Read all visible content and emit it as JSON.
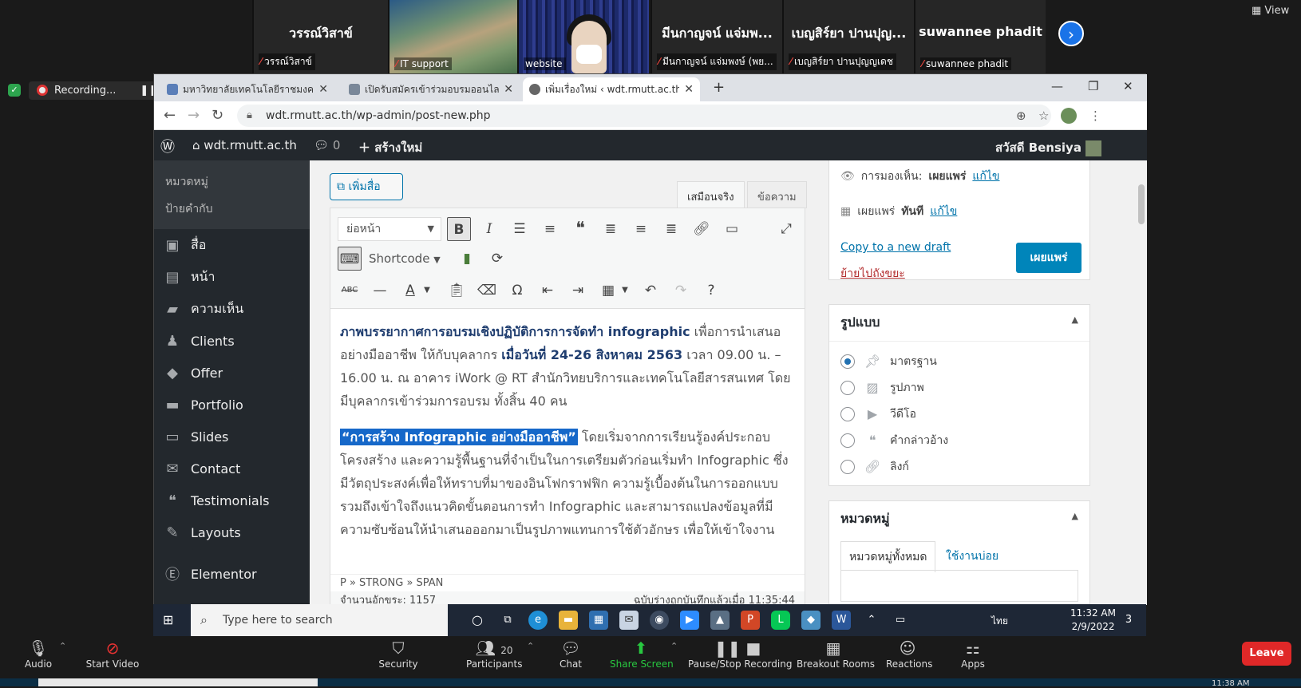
{
  "zoom": {
    "tiles": [
      {
        "name": "วรรณ์วิสาข์",
        "label": "วรรณ์วิสาข์"
      },
      {
        "name": "",
        "label": "IT support"
      },
      {
        "name": "",
        "label": "website"
      },
      {
        "name": "มีนกาญจน์ แจ่มพ...",
        "label": "มีนกาญจน์ แจ่มพงษ์ (พย..."
      },
      {
        "name": "เบญสิร์ยา ปานปุญ...",
        "label": "เบญสิร์ยา ปานปุญญเดช"
      },
      {
        "name": "suwannee phadit",
        "label": "suwannee phadit"
      }
    ],
    "view_label": "View",
    "recording_label": "Recording...",
    "controls": {
      "audio": "Audio",
      "start_video": "Start Video",
      "security": "Security",
      "participants": "Participants",
      "participants_count": "20",
      "chat": "Chat",
      "share_screen": "Share Screen",
      "pause_recording": "Pause/Stop Recording",
      "breakout_rooms": "Breakout Rooms",
      "reactions": "Reactions",
      "apps": "Apps",
      "leave": "Leave"
    },
    "bottom_time": "11:38 AM"
  },
  "browser": {
    "tabs": [
      {
        "title": "มหาวิทยาลัยเทคโนโลยีราชมงคลธัญบุรี"
      },
      {
        "title": "เปิดรับสมัครเข้าร่วมอบรมออนไลน์ สำห"
      },
      {
        "title": "เพิ่มเรื่องใหม่ ‹ wdt.rmutt.ac.th — W"
      }
    ],
    "url": "wdt.rmutt.ac.th/wp-admin/post-new.php"
  },
  "wp": {
    "site_name": "wdt.rmutt.ac.th",
    "comments_count": "0",
    "new_label": "สร้างใหม่",
    "greeting": "สวัสดี Bensiya",
    "submenu": [
      "หมวดหมู่",
      "ป้ายคำกับ"
    ],
    "menu": [
      {
        "label": "สื่อ",
        "icon": "media-icon"
      },
      {
        "label": "หน้า",
        "icon": "pages-icon"
      },
      {
        "label": "ความเห็น",
        "icon": "comments-icon"
      },
      {
        "label": "Clients",
        "icon": "clients-icon"
      },
      {
        "label": "Offer",
        "icon": "offer-icon"
      },
      {
        "label": "Portfolio",
        "icon": "portfolio-icon"
      },
      {
        "label": "Slides",
        "icon": "slides-icon"
      },
      {
        "label": "Contact",
        "icon": "contact-icon"
      },
      {
        "label": "Testimonials",
        "icon": "testimonials-icon"
      },
      {
        "label": "Layouts",
        "icon": "layouts-icon"
      },
      {
        "label": "Elementor",
        "icon": "elementor-icon"
      }
    ],
    "add_media": "เพิ่มสื่อ",
    "tab_visual": "เสมือนจริง",
    "tab_text": "ข้อความ",
    "format_select": "ย่อหน้า",
    "shortcode": "Shortcode",
    "content": {
      "p1_bold": "ภาพบรรยากาศการอบรมเชิงปฏิบัติการการจัดทำ infographic",
      "p1_a": " เพื่อการนำเสนออย่างมืออาชีพ ให้กับบุคลากร ",
      "p1_date": "เมื่อวันที่ 24-26 สิงหาคม 2563",
      "p1_b": " เวลา 09.00 น. – 16.00 น. ณ อาคาร iWork @ RT สำนักวิทยบริการและเทคโนโลยีสารสนเทศ โดยมีบุคลากรเข้าร่วมการอบรม ทั้งสิ้น 40 คน",
      "p2_highlight": "“การสร้าง Infographic อย่างมืออาชีพ”",
      "p2_rest": " โดยเริ่มจากการเรียนรู้องค์ประกอบโครงสร้าง และความรู้พื้นฐานที่จำเป็นในการเตรียมตัวก่อนเริ่มทำ Infographic ซึ่งมีวัตถุประสงค์เพื่อให้ทราบที่มาของอินโฟกราฟฟิก ความรู้เบื้องต้นในการออกแบบ รวมถึงเข้าใจถึงแนวคิดขั้นตอนการทำ Infographic และสามารถแปลงข้อมูลที่มีความซับซ้อนให้นำเสนอออกมาเป็นรูปภาพแทนการใช้ตัวอักษร เพื่อให้เข้าใจงาน"
    },
    "path": "P » STRONG » SPAN",
    "word_count": "จำนวนอักขระ: 1157",
    "draft_saved": "ฉบับร่างถูกบันทึกแล้วเมื่อ 11:35:44",
    "publish": {
      "visibility_label": "การมองเห็น:",
      "visibility_value": "เผยแพร่",
      "edit": "แก้ไข",
      "publish_label": "เผยแพร่",
      "publish_when": "ทันที",
      "copy_draft": "Copy to a new draft",
      "trash": "ย้ายไปถังขยะ",
      "button": "เผยแพร่"
    },
    "format_box": {
      "title": "รูปแบบ",
      "options": [
        {
          "label": "มาตรฐาน",
          "selected": true,
          "icon": "pin-icon"
        },
        {
          "label": "รูปภาพ",
          "selected": false,
          "icon": "image-icon"
        },
        {
          "label": "วีดีโอ",
          "selected": false,
          "icon": "video-icon"
        },
        {
          "label": "คำกล่าวอ้าง",
          "selected": false,
          "icon": "quote-icon"
        },
        {
          "label": "ลิงก์",
          "selected": false,
          "icon": "link-icon"
        }
      ]
    },
    "category_box": {
      "title": "หมวดหมู่",
      "tab_all": "หมวดหมู่ทั้งหมด",
      "tab_popular": "ใช้งานบ่อย"
    }
  },
  "taskbar": {
    "search_placeholder": "Type here to search",
    "lang": "ไทย",
    "time": "11:32 AM",
    "date": "2/9/2022",
    "notif_count": "3"
  },
  "colors": {
    "wp_dark": "#23282d",
    "wp_blue": "#0073aa",
    "highlight": "#1668c9",
    "zoom_leave": "#e02828",
    "share_green": "#28c840"
  }
}
